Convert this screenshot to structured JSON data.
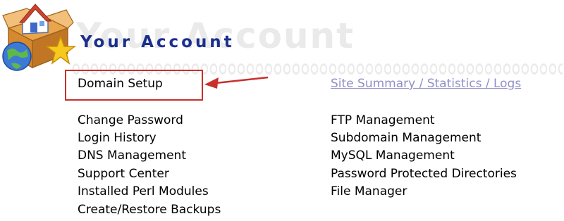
{
  "header": {
    "title": "Your Account",
    "ghost_title": "Your Account",
    "logo_icon": "house-globe-star-logo"
  },
  "links": {
    "domain_setup": "Domain Setup",
    "site_summary": "Site Summary / Statistics / Logs"
  },
  "left_menu": [
    "Change Password",
    "Login History",
    "DNS Management",
    "Support Center",
    "Installed Perl Modules",
    "Create/Restore Backups"
  ],
  "right_menu": [
    "FTP Management",
    "Subdomain Management",
    "MySQL Management",
    "Password Protected Directories",
    "File Manager"
  ],
  "annotation": {
    "highlight_color": "#c8302c"
  },
  "colors": {
    "title": "#1b2f8e",
    "link_visited": "#8f8fc8"
  }
}
